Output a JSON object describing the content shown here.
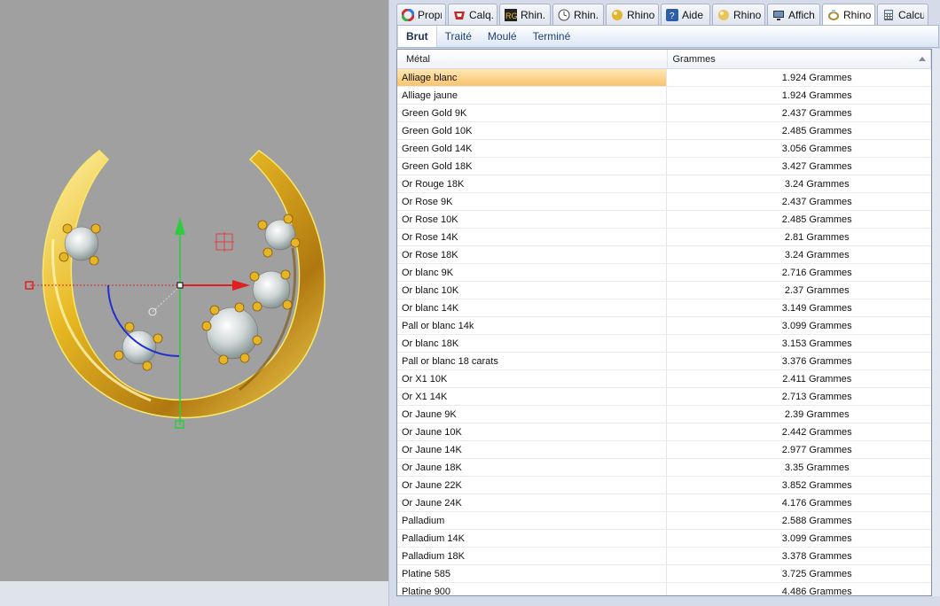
{
  "tabs": [
    {
      "label": "Propr...",
      "icon": "color-wheel-icon"
    },
    {
      "label": "Calq...",
      "icon": "layers-icon"
    },
    {
      "label": "Rhin...",
      "icon": "rhinogold-icon"
    },
    {
      "label": "Rhin...",
      "icon": "clock-icon"
    },
    {
      "label": "Rhino...",
      "icon": "gem-icon"
    },
    {
      "label": "Aide",
      "icon": "help-icon"
    },
    {
      "label": "Rhino...",
      "icon": "gold-ball-icon"
    },
    {
      "label": "Affich...",
      "icon": "monitor-icon"
    },
    {
      "label": "Rhino...",
      "icon": "ring-icon"
    },
    {
      "label": "Calcu...",
      "icon": "calculator-icon"
    }
  ],
  "subtabs": [
    "Brut",
    "Traité",
    "Moulé",
    "Terminé"
  ],
  "table": {
    "headers": [
      "Métal",
      "Grammes"
    ],
    "rows": [
      {
        "metal": "Alliage blanc",
        "grams": "1.924 Grammes"
      },
      {
        "metal": "Alliage jaune",
        "grams": "1.924 Grammes"
      },
      {
        "metal": "Green Gold 9K",
        "grams": "2.437 Grammes"
      },
      {
        "metal": "Green Gold 10K",
        "grams": "2.485 Grammes"
      },
      {
        "metal": "Green Gold 14K",
        "grams": "3.056 Grammes"
      },
      {
        "metal": "Green Gold 18K",
        "grams": "3.427 Grammes"
      },
      {
        "metal": "Or Rouge 18K",
        "grams": "3.24 Grammes"
      },
      {
        "metal": "Or Rose 9K",
        "grams": "2.437 Grammes"
      },
      {
        "metal": "Or Rose 10K",
        "grams": "2.485 Grammes"
      },
      {
        "metal": "Or Rose 14K",
        "grams": "2.81 Grammes"
      },
      {
        "metal": "Or Rose 18K",
        "grams": "3.24 Grammes"
      },
      {
        "metal": "Or blanc 9K",
        "grams": "2.716 Grammes"
      },
      {
        "metal": "Or blanc 10K",
        "grams": "2.37 Grammes"
      },
      {
        "metal": "Or blanc 14K",
        "grams": "3.149 Grammes"
      },
      {
        "metal": "Pall or blanc 14k",
        "grams": "3.099 Grammes"
      },
      {
        "metal": "Or blanc 18K",
        "grams": "3.153 Grammes"
      },
      {
        "metal": "Pall or blanc 18 carats",
        "grams": "3.376 Grammes"
      },
      {
        "metal": "Or X1 10K",
        "grams": "2.411 Grammes"
      },
      {
        "metal": "Or X1 14K",
        "grams": "2.713 Grammes"
      },
      {
        "metal": "Or Jaune 9K",
        "grams": "2.39 Grammes"
      },
      {
        "metal": "Or Jaune 10K",
        "grams": "2.442 Grammes"
      },
      {
        "metal": "Or Jaune 14K",
        "grams": "2.977 Grammes"
      },
      {
        "metal": "Or Jaune 18K",
        "grams": "3.35 Grammes"
      },
      {
        "metal": "Or Jaune 22K",
        "grams": "3.852 Grammes"
      },
      {
        "metal": "Or Jaune 24K",
        "grams": "4.176 Grammes"
      },
      {
        "metal": "Palladium",
        "grams": "2.588 Grammes"
      },
      {
        "metal": "Palladium 14K",
        "grams": "3.099 Grammes"
      },
      {
        "metal": "Palladium 18K",
        "grams": "3.378 Grammes"
      },
      {
        "metal": "Platine 585",
        "grams": "3.725 Grammes"
      },
      {
        "metal": "Platine 900",
        "grams": "4.486 Grammes"
      }
    ]
  },
  "colors": {
    "viewport_bg": "#a0a0a0",
    "gold": "#e8b923",
    "gizmo_x": "#e02020",
    "gizmo_y": "#2ecc40",
    "selection": "#f9c36c"
  }
}
